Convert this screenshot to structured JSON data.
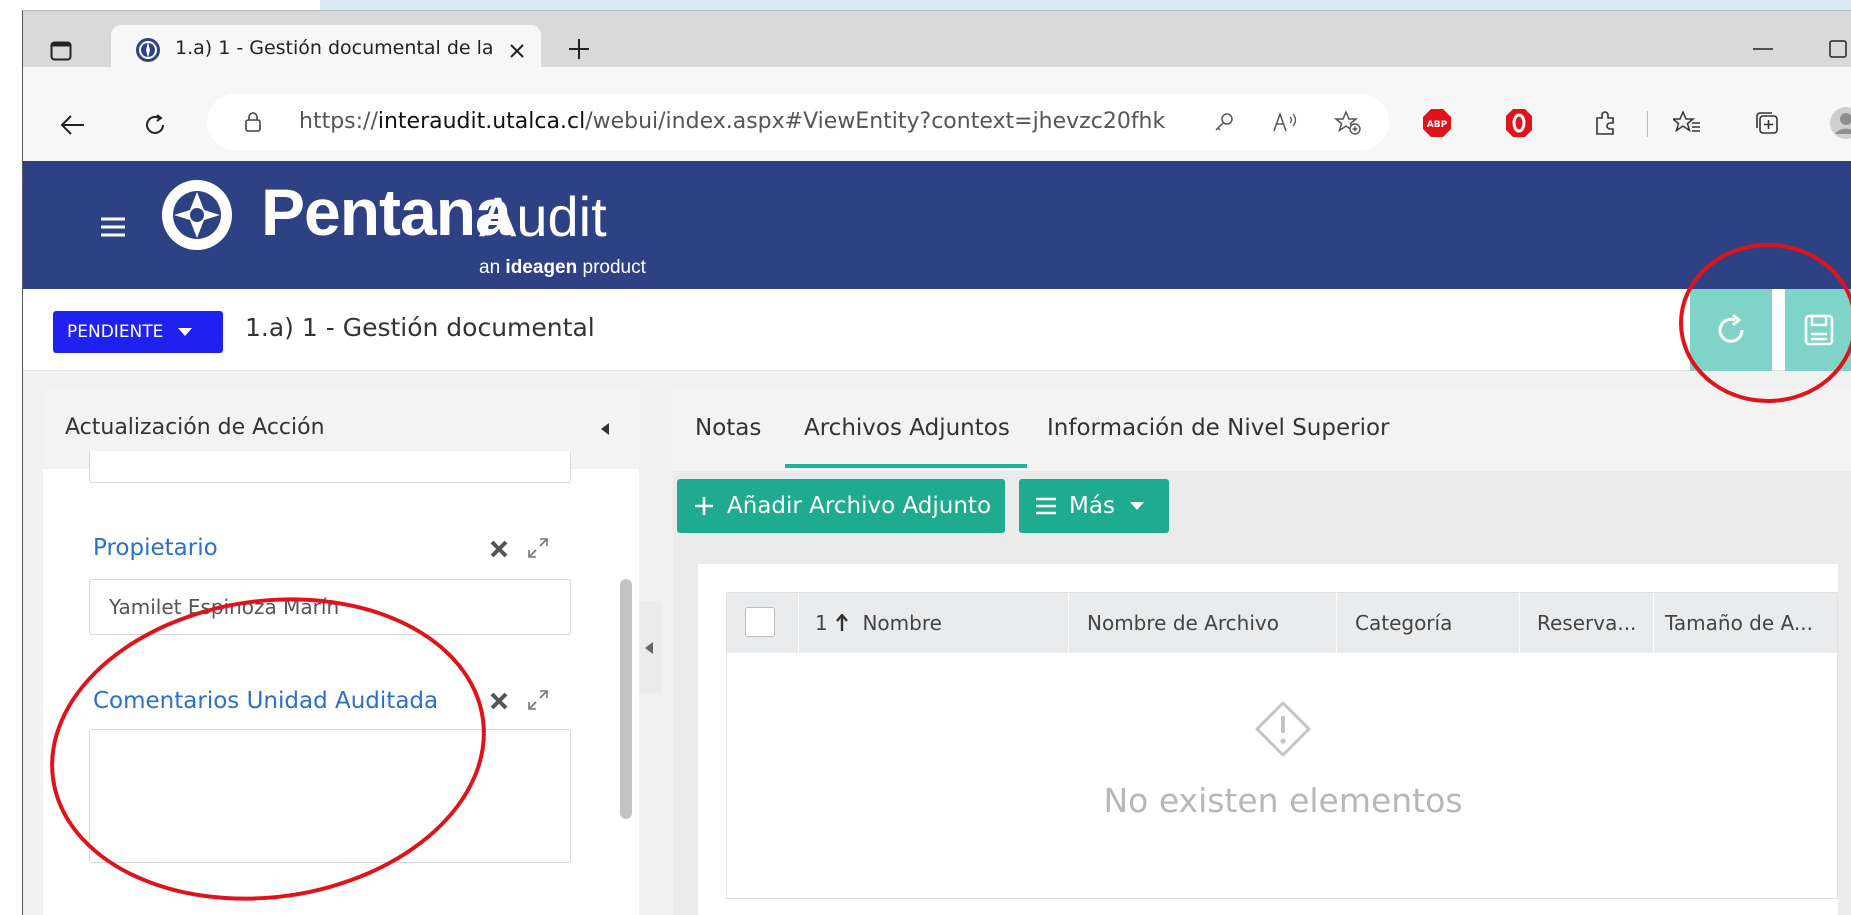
{
  "browser": {
    "tab_title": "1.a) 1 - Gestión documental de la",
    "url_prefix": "https://",
    "url_domain": "interaudit.utalca.cl",
    "url_path": "/webui/index.aspx#ViewEntity?context=jhevzc20fhk",
    "ext_abp": "ABP"
  },
  "app": {
    "logo_name": "Pentana",
    "logo_product": "Audit",
    "logo_sub_prefix": "an ",
    "logo_sub_brand": "ideagen",
    "logo_sub_suffix": " product",
    "header_color": "#2e4185"
  },
  "subheader": {
    "status": "PENDIENTE",
    "title": "1.a) 1 - Gestión documental",
    "status_color": "#1e21f0",
    "action_color": "#7fd3c9"
  },
  "left_panel": {
    "header": "Actualización de Acción",
    "owner_label": "Propietario",
    "owner_value": "Yamilet Espinoza Marín",
    "comments_label": "Comentarios Unidad Auditada",
    "comments_value": ""
  },
  "right_panel": {
    "tabs": [
      {
        "label": "Notas"
      },
      {
        "label": "Archivos Adjuntos",
        "active": true
      },
      {
        "label": "Información de Nivel Superior"
      }
    ],
    "add_button": "Añadir Archivo Adjunto",
    "more_button": "Más",
    "accent_color": "#1fab8f"
  },
  "grid": {
    "sort_index": "1",
    "columns": [
      "Nombre",
      "Nombre de Archivo",
      "Categoría",
      "Reserva...",
      "Tamaño de A..."
    ],
    "empty_message": "No existen elementos"
  },
  "annotation_color": "#e0131b"
}
